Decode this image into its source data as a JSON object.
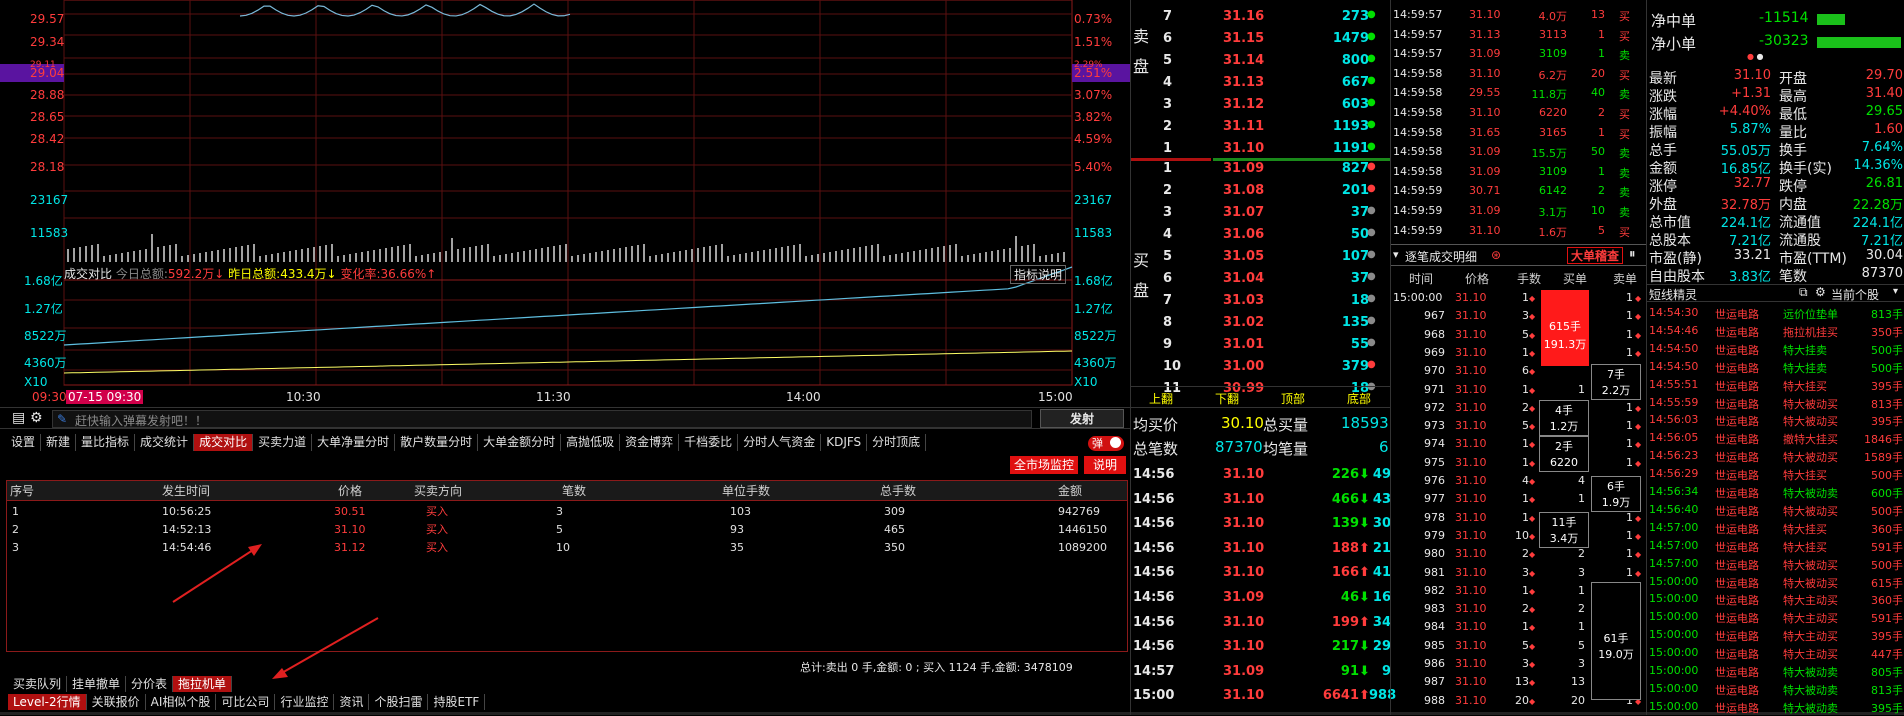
{
  "chart": {
    "price_left": [
      "29.57",
      "29.34",
      "29.11",
      "29.04",
      "28.88",
      "28.65",
      "28.42",
      "28.18",
      "23167",
      "11583"
    ],
    "pct_right": [
      "0.73%",
      "1.51%",
      "2.29%",
      "2.51%",
      "3.07%",
      "3.82%",
      "4.59%",
      "5.40%",
      "23167",
      "11583"
    ],
    "vol_left": [
      "1.68亿",
      "1.27亿",
      "8522万",
      "4360万",
      "X10"
    ],
    "vol_right": [
      "1.68亿",
      "1.27亿",
      "8522万",
      "4360万",
      "X10"
    ],
    "times": [
      "09:30",
      "07-15 09:30",
      "10:30",
      "11:30",
      "14:00",
      "15:00"
    ],
    "info_bar": {
      "label1": "成交对比",
      "label2": "今日总额:",
      "val2": "592.2万↓",
      "label3": "昨日总额:",
      "val3": "433.4万↓",
      "label4": "变化率:",
      "val4": "36.66%↑",
      "right": "指标说明"
    }
  },
  "comment_bar": {
    "placeholder": "赶快输入弹幕发射吧！！",
    "send": "发射"
  },
  "indicator_tabs": [
    "设置",
    "新建",
    "量比指标",
    "成交统计",
    "成交对比",
    "买卖力道",
    "大单净量分时",
    "散户数量分时",
    "大单金额分时",
    "高抛低吸",
    "资金博弈",
    "千档委比",
    "分时人气资金",
    "KDJFS",
    "分时顶底"
  ],
  "active_indicator": "成交对比",
  "toggle_label": "弹",
  "buttons": {
    "market_monitor": "全市场监控",
    "explain": "说明"
  },
  "trade_table": {
    "headers": [
      "序号",
      "发生时间",
      "价格",
      "买卖方向",
      "笔数",
      "单位手数",
      "总手数",
      "金额"
    ],
    "rows": [
      [
        "1",
        "10:56:25",
        "30.51",
        "买入",
        "3",
        "103",
        "309",
        "942769"
      ],
      [
        "2",
        "14:52:13",
        "31.10",
        "买入",
        "5",
        "93",
        "465",
        "1446150"
      ],
      [
        "3",
        "14:54:46",
        "31.12",
        "买入",
        "10",
        "35",
        "350",
        "1089200"
      ]
    ],
    "summary": "总计:卖出 0 手,金额: 0 ; 买入 1124 手,金额: 3478109"
  },
  "bottom_tabs1": [
    "买卖队列",
    "挂单撤单",
    "分价表",
    "拖拉机单"
  ],
  "bottom_tabs1_active": "拖拉机单",
  "bottom_tabs2": [
    "Level-2行情",
    "关联报价",
    "AI相似个股",
    "可比公司",
    "行业监控",
    "资讯",
    "个股扫雷",
    "持股ETF"
  ],
  "bottom_tabs2_active": "Level-2行情",
  "order_book": {
    "sell_label": [
      "卖",
      "盘"
    ],
    "buy_label": [
      "买",
      "盘"
    ],
    "sell": [
      {
        "n": "7",
        "p": "31.16",
        "v": "273"
      },
      {
        "n": "6",
        "p": "31.15",
        "v": "1479"
      },
      {
        "n": "5",
        "p": "31.14",
        "v": "800"
      },
      {
        "n": "4",
        "p": "31.13",
        "v": "667"
      },
      {
        "n": "3",
        "p": "31.12",
        "v": "603"
      },
      {
        "n": "2",
        "p": "31.11",
        "v": "1193"
      },
      {
        "n": "1",
        "p": "31.10",
        "v": "1191"
      }
    ],
    "buy": [
      {
        "n": "1",
        "p": "31.09",
        "v": "827"
      },
      {
        "n": "2",
        "p": "31.08",
        "v": "201"
      },
      {
        "n": "3",
        "p": "31.07",
        "v": "37"
      },
      {
        "n": "4",
        "p": "31.06",
        "v": "50"
      },
      {
        "n": "5",
        "p": "31.05",
        "v": "107"
      },
      {
        "n": "6",
        "p": "31.04",
        "v": "37"
      },
      {
        "n": "7",
        "p": "31.03",
        "v": "18"
      },
      {
        "n": "8",
        "p": "31.02",
        "v": "135"
      },
      {
        "n": "9",
        "p": "31.01",
        "v": "55"
      },
      {
        "n": "10",
        "p": "31.00",
        "v": "379"
      },
      {
        "n": "11",
        "p": "30.99",
        "v": "18"
      }
    ],
    "nav": [
      "上翻",
      "下翻",
      "顶部",
      "底部"
    ],
    "avg_buy_label": "均买价",
    "avg_buy": "30.10",
    "total_qty_label": "总买量",
    "total_qty": "18593",
    "total_count_label": "总笔数",
    "total_count": "87370",
    "avg_qty_label": "均笔量",
    "avg_qty": "6",
    "minute_ticks": [
      {
        "t": "14:56",
        "p": "31.10",
        "v": "226",
        "d": "dn",
        "c": "49"
      },
      {
        "t": "14:56",
        "p": "31.10",
        "v": "466",
        "d": "dn",
        "c": "43"
      },
      {
        "t": "14:56",
        "p": "31.10",
        "v": "139",
        "d": "dn",
        "c": "30"
      },
      {
        "t": "14:56",
        "p": "31.10",
        "v": "188",
        "d": "up",
        "c": "21"
      },
      {
        "t": "14:56",
        "p": "31.10",
        "v": "166",
        "d": "up",
        "c": "41"
      },
      {
        "t": "14:56",
        "p": "31.09",
        "v": "46",
        "d": "dn",
        "c": "16"
      },
      {
        "t": "14:56",
        "p": "31.10",
        "v": "199",
        "d": "up",
        "c": "34"
      },
      {
        "t": "14:56",
        "p": "31.10",
        "v": "217",
        "d": "dn",
        "c": "29"
      },
      {
        "t": "14:57",
        "p": "31.09",
        "v": "91",
        "d": "dn",
        "c": "9"
      },
      {
        "t": "15:00",
        "p": "31.10",
        "v": "6641",
        "d": "up",
        "c": "988"
      }
    ]
  },
  "tick_list": {
    "rows": [
      {
        "t": "14:59:57",
        "p": "31.10",
        "v": "4.0万",
        "n": "13",
        "s": "买"
      },
      {
        "t": "14:59:57",
        "p": "31.13",
        "v": "3113",
        "n": "1",
        "s": "买"
      },
      {
        "t": "14:59:57",
        "p": "31.09",
        "v": "3109",
        "n": "1",
        "s": "卖"
      },
      {
        "t": "14:59:58",
        "p": "31.10",
        "v": "6.2万",
        "n": "20",
        "s": "买"
      },
      {
        "t": "14:59:58",
        "p": "29.55",
        "v": "11.8万",
        "n": "40",
        "s": "卖"
      },
      {
        "t": "14:59:58",
        "p": "31.10",
        "v": "6220",
        "n": "2",
        "s": "买"
      },
      {
        "t": "14:59:58",
        "p": "31.65",
        "v": "3165",
        "n": "1",
        "s": "买"
      },
      {
        "t": "14:59:58",
        "p": "31.09",
        "v": "15.5万",
        "n": "50",
        "s": "卖"
      },
      {
        "t": "14:59:58",
        "p": "31.09",
        "v": "3109",
        "n": "1",
        "s": "卖"
      },
      {
        "t": "14:59:59",
        "p": "30.71",
        "v": "6142",
        "n": "2",
        "s": "卖"
      },
      {
        "t": "14:59:59",
        "p": "31.09",
        "v": "3.1万",
        "n": "10",
        "s": "卖"
      },
      {
        "t": "14:59:59",
        "p": "31.10",
        "v": "1.6万",
        "n": "5",
        "s": "买"
      }
    ],
    "section_title": "逐笔成交明细",
    "section_btn": "大单稽查",
    "headers": [
      "时间",
      "价格",
      "手数",
      "买单",
      "卖单"
    ],
    "big_rows": [
      {
        "t": "15:00:00",
        "p": "31.10",
        "h": "1",
        "b": "1",
        "s": "1"
      },
      {
        "t": "967",
        "p": "31.10",
        "h": "3",
        "b": "",
        "s": "1"
      },
      {
        "t": "968",
        "p": "31.10",
        "h": "5",
        "b": "",
        "s": "1"
      },
      {
        "t": "969",
        "p": "31.10",
        "h": "1",
        "b": "",
        "s": "1"
      },
      {
        "t": "970",
        "p": "31.10",
        "h": "6",
        "b": "",
        "s": "1"
      },
      {
        "t": "971",
        "p": "31.10",
        "h": "1",
        "b": "1",
        "s": "1"
      },
      {
        "t": "972",
        "p": "31.10",
        "h": "2",
        "b": "",
        "s": "1"
      },
      {
        "t": "973",
        "p": "31.10",
        "h": "5",
        "b": "",
        "s": "1"
      },
      {
        "t": "974",
        "p": "31.10",
        "h": "1",
        "b": "",
        "s": "1"
      },
      {
        "t": "975",
        "p": "31.10",
        "h": "1",
        "b": "",
        "s": "1"
      },
      {
        "t": "976",
        "p": "31.10",
        "h": "4",
        "b": "4",
        "s": "1"
      },
      {
        "t": "977",
        "p": "31.10",
        "h": "1",
        "b": "1",
        "s": "1"
      },
      {
        "t": "978",
        "p": "31.10",
        "h": "1",
        "b": "",
        "s": "1"
      },
      {
        "t": "979",
        "p": "31.10",
        "h": "10",
        "b": "",
        "s": "1"
      },
      {
        "t": "980",
        "p": "31.10",
        "h": "2",
        "b": "2",
        "s": "1"
      },
      {
        "t": "981",
        "p": "31.10",
        "h": "3",
        "b": "3",
        "s": "1"
      },
      {
        "t": "982",
        "p": "31.10",
        "h": "1",
        "b": "1",
        "s": "1"
      },
      {
        "t": "983",
        "p": "31.10",
        "h": "2",
        "b": "2",
        "s": "1"
      },
      {
        "t": "984",
        "p": "31.10",
        "h": "1",
        "b": "1",
        "s": "1"
      },
      {
        "t": "985",
        "p": "31.10",
        "h": "5",
        "b": "5",
        "s": "1"
      },
      {
        "t": "986",
        "p": "31.10",
        "h": "3",
        "b": "3",
        "s": "1"
      },
      {
        "t": "987",
        "p": "31.10",
        "h": "13",
        "b": "13",
        "s": "1"
      },
      {
        "t": "988",
        "p": "31.10",
        "h": "20",
        "b": "20",
        "s": "1"
      }
    ],
    "big_buy": {
      "a": "615手",
      "b": "191.3万"
    },
    "sell_boxes": [
      {
        "a": "7手",
        "b": "2.2万"
      },
      {
        "a": "4手",
        "b": "1.2万"
      },
      {
        "a": "2手",
        "b": "6220"
      },
      {
        "a": "11手",
        "b": "3.4万"
      },
      {
        "a": "6手",
        "b": "1.9万"
      },
      {
        "a": "61手",
        "b": "19.0万"
      }
    ]
  },
  "info_panel": {
    "net": [
      {
        "label": "净中单",
        "value": "-11514"
      },
      {
        "label": "净小单",
        "value": "-30323"
      }
    ],
    "quotes": [
      [
        "最新",
        "31.10",
        "开盘",
        "29.70"
      ],
      [
        "涨跌",
        "+1.31",
        "最高",
        "31.40"
      ],
      [
        "涨幅",
        "+4.40%",
        "最低",
        "29.65"
      ],
      [
        "振幅",
        "5.87%",
        "量比",
        "1.60"
      ],
      [
        "总手",
        "55.05万",
        "换手",
        "7.64%"
      ],
      [
        "金额",
        "16.85亿",
        "换手(实)",
        "14.36%"
      ],
      [
        "涨停",
        "32.77",
        "跌停",
        "26.81"
      ],
      [
        "外盘",
        "32.78万",
        "内盘",
        "22.28万"
      ],
      [
        "总市值",
        "224.1亿",
        "流通值",
        "224.1亿"
      ],
      [
        "总股本",
        "7.21亿",
        "流通股",
        "7.21亿"
      ],
      [
        "市盈(静)",
        "33.21",
        "市盈(TTM)",
        "30.04"
      ],
      [
        "自由股本",
        "3.83亿",
        "笔数",
        "87370"
      ]
    ],
    "sprite_title": "短线精灵",
    "sprite_dropdown": "当前个股",
    "sprite_rows": [
      {
        "t": "14:54:30",
        "n": "世运电路",
        "e": "远价位垫单",
        "v": "813手"
      },
      {
        "t": "14:54:46",
        "n": "世运电路",
        "e": "拖拉机挂买",
        "v": "350手"
      },
      {
        "t": "14:54:50",
        "n": "世运电路",
        "e": "特大挂卖",
        "v": "500手"
      },
      {
        "t": "14:54:50",
        "n": "世运电路",
        "e": "特大挂卖",
        "v": "500手"
      },
      {
        "t": "14:55:51",
        "n": "世运电路",
        "e": "特大挂买",
        "v": "395手"
      },
      {
        "t": "14:55:59",
        "n": "世运电路",
        "e": "特大被动买",
        "v": "813手"
      },
      {
        "t": "14:56:03",
        "n": "世运电路",
        "e": "特大被动买",
        "v": "395手"
      },
      {
        "t": "14:56:05",
        "n": "世运电路",
        "e": "撤特大挂买",
        "v": "1846手"
      },
      {
        "t": "14:56:23",
        "n": "世运电路",
        "e": "特大被动买",
        "v": "1589手"
      },
      {
        "t": "14:56:29",
        "n": "世运电路",
        "e": "特大挂买",
        "v": "500手"
      },
      {
        "t": "14:56:34",
        "n": "世运电路",
        "e": "特大被动卖",
        "v": "600手"
      },
      {
        "t": "14:56:40",
        "n": "世运电路",
        "e": "特大被动买",
        "v": "500手"
      },
      {
        "t": "14:57:00",
        "n": "世运电路",
        "e": "特大挂买",
        "v": "360手"
      },
      {
        "t": "14:57:00",
        "n": "世运电路",
        "e": "特大挂买",
        "v": "591手"
      },
      {
        "t": "14:57:00",
        "n": "世运电路",
        "e": "特大被动买",
        "v": "500手"
      },
      {
        "t": "15:00:00",
        "n": "世运电路",
        "e": "特大被动买",
        "v": "615手"
      },
      {
        "t": "15:00:00",
        "n": "世运电路",
        "e": "特大主动买",
        "v": "360手"
      },
      {
        "t": "15:00:00",
        "n": "世运电路",
        "e": "特大主动买",
        "v": "591手"
      },
      {
        "t": "15:00:00",
        "n": "世运电路",
        "e": "特大主动买",
        "v": "395手"
      },
      {
        "t": "15:00:00",
        "n": "世运电路",
        "e": "特大主动买",
        "v": "447手"
      },
      {
        "t": "15:00:00",
        "n": "世运电路",
        "e": "特大被动卖",
        "v": "805手"
      },
      {
        "t": "15:00:00",
        "n": "世运电路",
        "e": "特大被动卖",
        "v": "813手"
      },
      {
        "t": "15:00:00",
        "n": "世运电路",
        "e": "特大被动卖",
        "v": "395手"
      }
    ]
  }
}
